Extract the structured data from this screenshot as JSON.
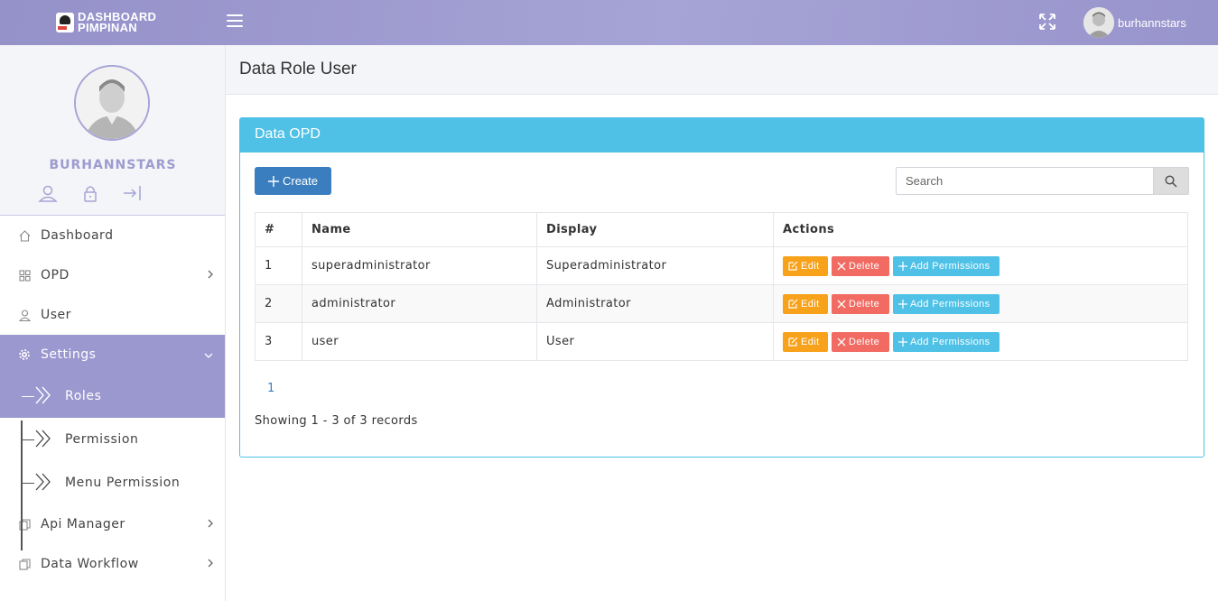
{
  "app": {
    "logo_line1": "DASHBOARD",
    "logo_line2": "PIMPINAN",
    "username": "burhannstars"
  },
  "sidebar": {
    "profile_name": "BURHANNSTARS",
    "items": [
      {
        "label": "Dashboard",
        "icon": "home-icon"
      },
      {
        "label": "OPD",
        "icon": "grid-icon"
      },
      {
        "label": "User",
        "icon": "user-icon"
      },
      {
        "label": "Settings",
        "icon": "gear-icon"
      },
      {
        "label": "Api Manager",
        "icon": "copy-icon"
      },
      {
        "label": "Data Workflow",
        "icon": "copy-icon"
      }
    ],
    "settings_sub": [
      {
        "label": "Roles"
      },
      {
        "label": "Permission"
      },
      {
        "label": "Menu Permission"
      }
    ],
    "accent_color": "#9b97cf"
  },
  "page": {
    "title": "Data Role User",
    "panel_title": "Data OPD",
    "create_label": "Create",
    "search_placeholder": "Search",
    "table": {
      "headers": [
        "#",
        "Name",
        "Display",
        "Actions"
      ],
      "rows": [
        {
          "num": "1",
          "name": "superadministrator",
          "display": "Superadministrator"
        },
        {
          "num": "2",
          "name": "administrator",
          "display": "Administrator"
        },
        {
          "num": "3",
          "name": "user",
          "display": "User"
        }
      ]
    },
    "actions": {
      "edit": "Edit",
      "delete": "Delete",
      "add_permissions": "Add Permissions"
    },
    "pagination_current": "1",
    "records_text": "Showing 1 - 3 of 3 records"
  }
}
